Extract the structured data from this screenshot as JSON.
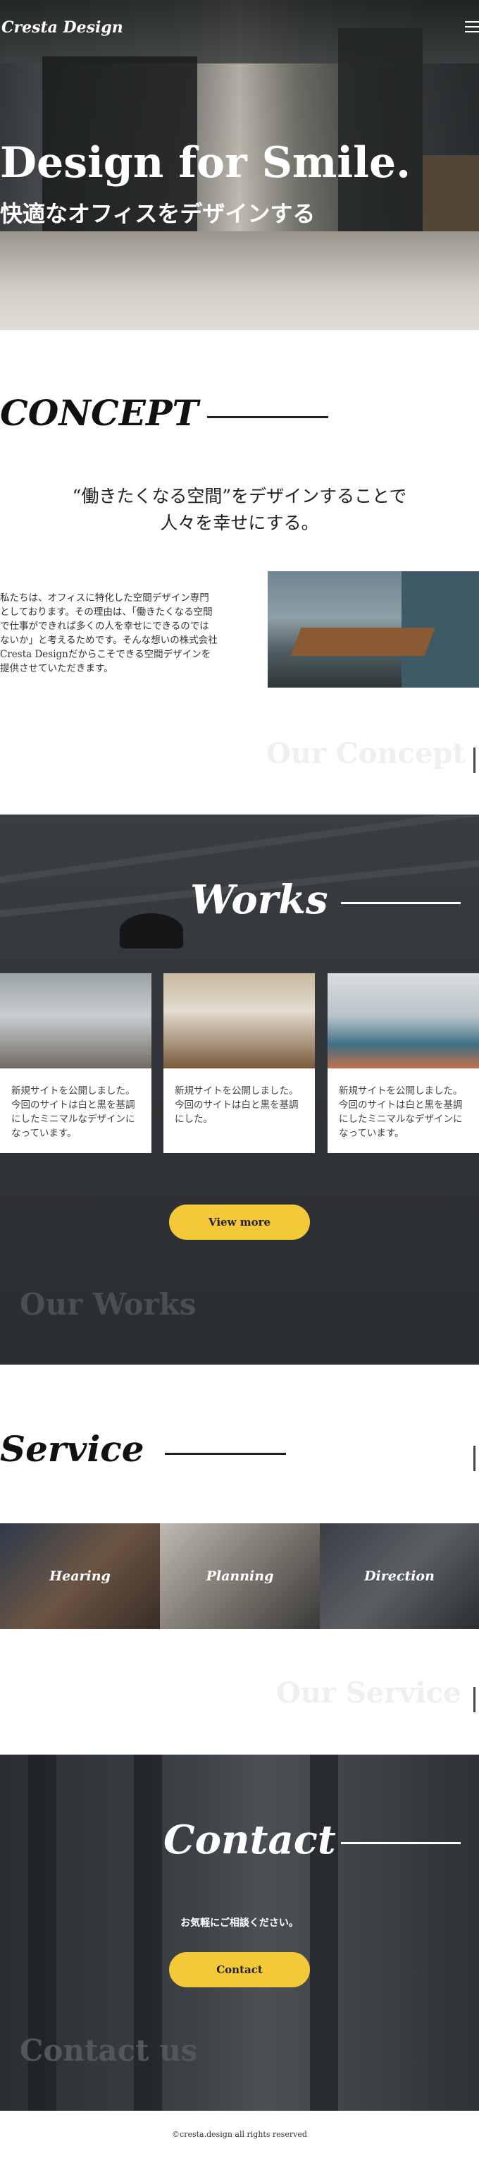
{
  "header": {
    "logo": "Cresta Design",
    "menu_icon": "hamburger-menu-icon"
  },
  "hero": {
    "title": "Design for Smile.",
    "subtitle": "快適なオフィスをデザインする"
  },
  "concept": {
    "heading": "CONCEPT",
    "lead_line1": "“働きたくなる空間”をデザインすることで",
    "lead_line2": "人々を幸せにする。",
    "body": "私たちは、オフィスに特化した空間デザイン専門としております。その理由は、「働きたくなる空間で仕事ができれば多くの人を幸せにできるのではないか」と考えるためです。そんな想いの株式会社Cresta Designだからこそできる空間デザインを提供させていただきます。",
    "ghost": "Our Concept"
  },
  "works": {
    "heading": "Works",
    "cards": [
      {
        "text": "新規サイトを公開しました。今回のサイトは白と黒を基調にしたミニマルなデザインになっています。"
      },
      {
        "text": "新規サイトを公開しました。今回のサイトは白と黒を基調にした。"
      },
      {
        "text": "新規サイトを公開しました。今回のサイトは白と黒を基調にしたミニマルなデザインになっています。"
      }
    ],
    "button": "View more",
    "ghost": "Our Works"
  },
  "service": {
    "heading": "Service",
    "items": [
      {
        "label": "Hearing"
      },
      {
        "label": "Planning"
      },
      {
        "label": "Direction"
      }
    ],
    "ghost": "Our Service"
  },
  "contact": {
    "heading": "Contact",
    "message": "お気軽にご相談ください。",
    "button": "Contact",
    "ghost": "Contact us"
  },
  "footer": {
    "copyright": "©cresta.design all rights reserved"
  },
  "colors": {
    "accent": "#f3c93a",
    "dark": "#303337"
  }
}
